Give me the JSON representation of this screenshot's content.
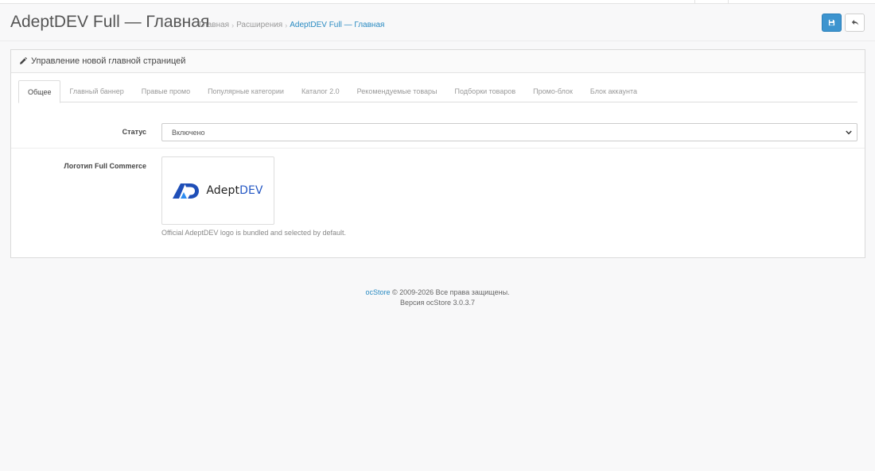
{
  "header": {
    "title": "AdeptDEV Full — Главная",
    "breadcrumb": [
      {
        "label": "Главная"
      },
      {
        "label": "Расширения"
      },
      {
        "label": "AdeptDEV Full — Главная"
      }
    ],
    "breadcrumb_divider": "›"
  },
  "panel": {
    "title": "Управление новой главной страницей",
    "tabs": [
      {
        "label": "Общее",
        "active": true
      },
      {
        "label": "Главный баннер"
      },
      {
        "label": "Правые промо"
      },
      {
        "label": "Популярные категории"
      },
      {
        "label": "Каталог 2.0"
      },
      {
        "label": "Рекомендуемые товары"
      },
      {
        "label": "Подборки товаров"
      },
      {
        "label": "Промо-блок"
      },
      {
        "label": "Блок аккаунта"
      }
    ],
    "status_label": "Статус",
    "status_value": "Включено",
    "logo_label": "Логотип Full Commerce",
    "logo": {
      "word_main": "Adept",
      "word_accent": "DEV",
      "accent_color": "#2558c4"
    },
    "logo_help": "Official AdeptDEV logo is bundled and selected by default."
  },
  "footer": {
    "brand": "ocStore",
    "copyright": "© 2009-2026 Все права защищены.",
    "version": "Версия ocStore 3.0.3.7"
  },
  "colors": {
    "primary": "#3d94cf",
    "link": "#2a8bc2"
  }
}
